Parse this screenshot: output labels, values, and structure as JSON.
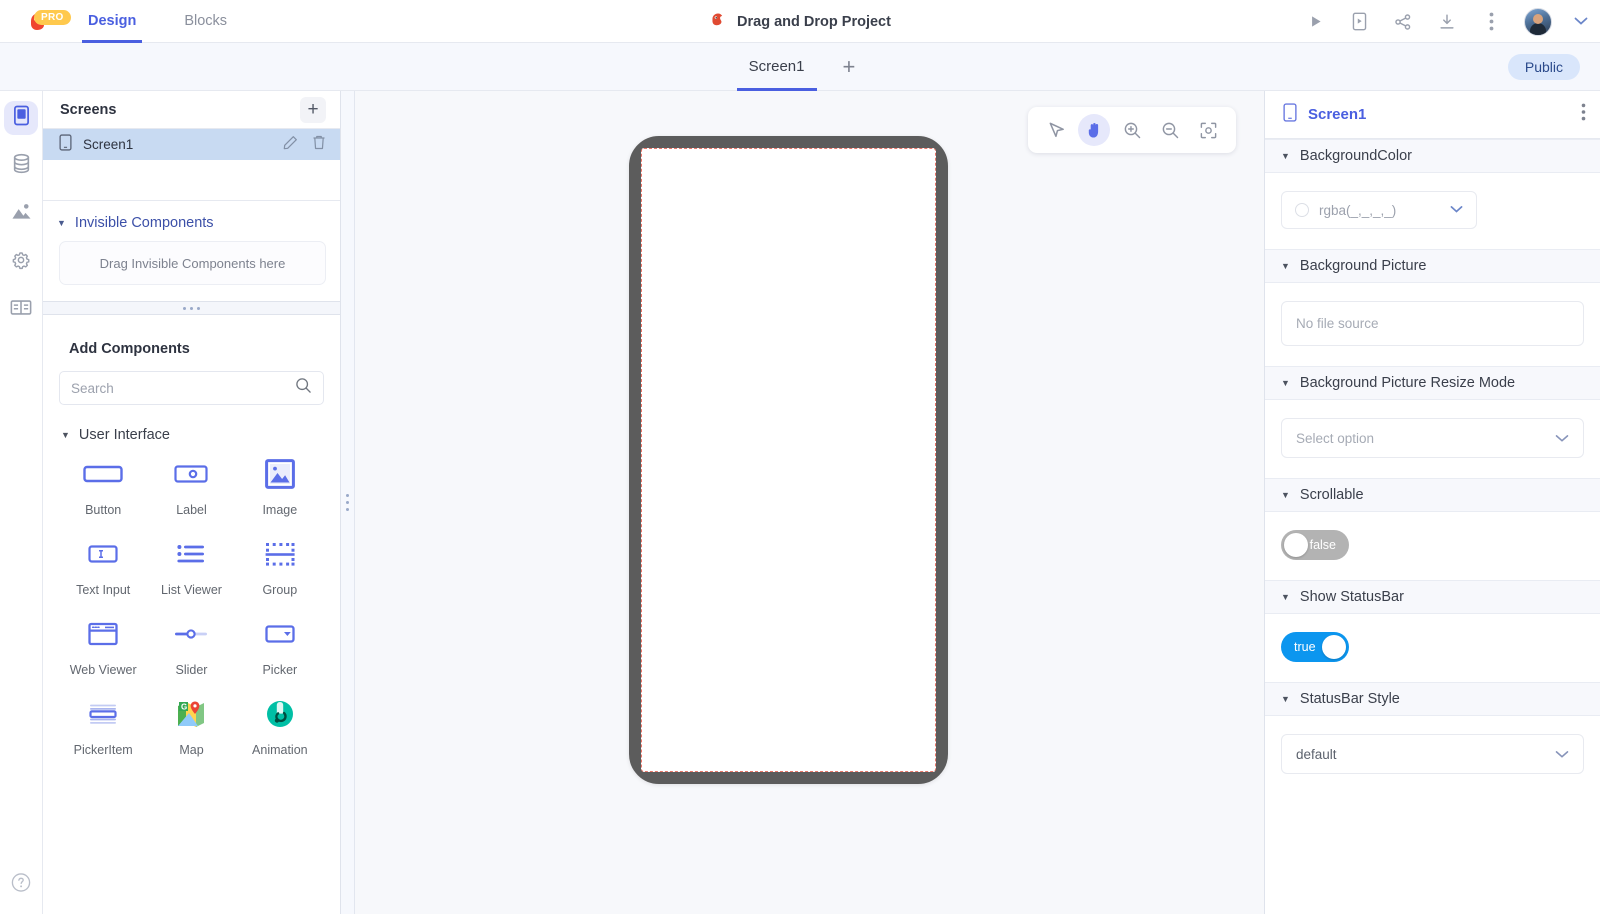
{
  "topbar": {
    "pro_badge": "PRO",
    "logo_icon": "kodular-bird-logo",
    "tabs": [
      {
        "label": "Design",
        "active": true
      },
      {
        "label": "Blocks",
        "active": false
      }
    ],
    "project_icon": "project-bird-icon",
    "project_title": "Drag and Drop Project",
    "actions": [
      {
        "icon": "play-icon",
        "name": "run-button"
      },
      {
        "icon": "phone-preview-icon",
        "name": "live-preview-button"
      },
      {
        "icon": "share-icon",
        "name": "share-button"
      },
      {
        "icon": "download-icon",
        "name": "download-button"
      },
      {
        "icon": "kebab-menu-icon",
        "name": "more-options-button"
      }
    ],
    "avatar": "user-avatar",
    "account_chevron": "chevron-down-icon"
  },
  "screenbar": {
    "tabs": [
      {
        "label": "Screen1",
        "active": true
      }
    ],
    "add_label": "+",
    "visibility_badge": "Public"
  },
  "rail": {
    "items": [
      {
        "name": "designer",
        "icon": "phone-screen-icon",
        "active": true
      },
      {
        "name": "database",
        "icon": "database-icon",
        "active": false
      },
      {
        "name": "assets",
        "icon": "image-icon",
        "active": false
      },
      {
        "name": "settings",
        "icon": "gear-icon",
        "active": false
      },
      {
        "name": "layouts",
        "icon": "panels-icon",
        "active": false
      }
    ],
    "help": "help-circle-icon"
  },
  "screens_panel": {
    "title": "Screens",
    "add_button": "+",
    "items": [
      {
        "label": "Screen1",
        "icon": "phone-icon",
        "selected": true,
        "edit": "pencil-icon",
        "delete": "trash-icon"
      }
    ]
  },
  "invisible_panel": {
    "caret": "▼",
    "title": "Invisible Components",
    "dropzone_text": "Drag Invisible Components here"
  },
  "add_components": {
    "title": "Add Components",
    "search_placeholder": "Search",
    "search_value": "",
    "search_icon": "search-icon",
    "groups": [
      {
        "caret": "▼",
        "title": "User Interface",
        "items": [
          {
            "label": "Button",
            "icon": "button-icon"
          },
          {
            "label": "Label",
            "icon": "label-icon"
          },
          {
            "label": "Image",
            "icon": "image-icon"
          },
          {
            "label": "Text Input",
            "icon": "text-input-icon"
          },
          {
            "label": "List Viewer",
            "icon": "list-viewer-icon"
          },
          {
            "label": "Group",
            "icon": "group-icon"
          },
          {
            "label": "Web Viewer",
            "icon": "web-viewer-icon"
          },
          {
            "label": "Slider",
            "icon": "slider-icon"
          },
          {
            "label": "Picker",
            "icon": "picker-icon"
          },
          {
            "label": "PickerItem",
            "icon": "picker-item-icon"
          },
          {
            "label": "Map",
            "icon": "map-icon"
          },
          {
            "label": "Animation",
            "icon": "animation-icon"
          }
        ]
      }
    ]
  },
  "canvas": {
    "tools": [
      {
        "name": "select-tool",
        "icon": "cursor-arrow-icon",
        "active": false
      },
      {
        "name": "pan-tool",
        "icon": "hand-icon",
        "active": true
      },
      {
        "name": "zoom-in-tool",
        "icon": "zoom-in-icon",
        "active": false
      },
      {
        "name": "zoom-out-tool",
        "icon": "zoom-out-icon",
        "active": false
      },
      {
        "name": "fit-screen-tool",
        "icon": "fit-to-screen-icon",
        "active": false
      }
    ],
    "device_frame": "phone-preview-frame"
  },
  "properties": {
    "header_icon": "phone-icon",
    "header_title": "Screen1",
    "header_menu": "kebab-menu-icon",
    "sections": [
      {
        "caret": "▼",
        "label": "BackgroundColor",
        "control": "color",
        "value": "rgba(_,_,_,_)",
        "chevron": "chevron-down-icon"
      },
      {
        "caret": "▼",
        "label": "Background Picture",
        "control": "text",
        "placeholder": "No file source"
      },
      {
        "caret": "▼",
        "label": "Background Picture Resize Mode",
        "control": "select",
        "placeholder": "Select option",
        "chevron": "chevron-down-icon"
      },
      {
        "caret": "▼",
        "label": "Scrollable",
        "control": "toggle",
        "state": "off",
        "value": "false"
      },
      {
        "caret": "▼",
        "label": "Show StatusBar",
        "control": "toggle",
        "state": "on",
        "value": "true"
      },
      {
        "caret": "▼",
        "label": "StatusBar Style",
        "control": "select",
        "value": "default",
        "chevron": "chevron-down-icon"
      }
    ]
  },
  "colors": {
    "accent": "#4a5fe0",
    "toggle_on": "#0c96ef",
    "toggle_off": "#b3b3b3",
    "selection": "#c8daf2",
    "badge": "#d9e6fb",
    "phone_bezel": "#5c5c5c",
    "phone_outline": "#e8776a",
    "pro_badge": "#ffc94d"
  }
}
